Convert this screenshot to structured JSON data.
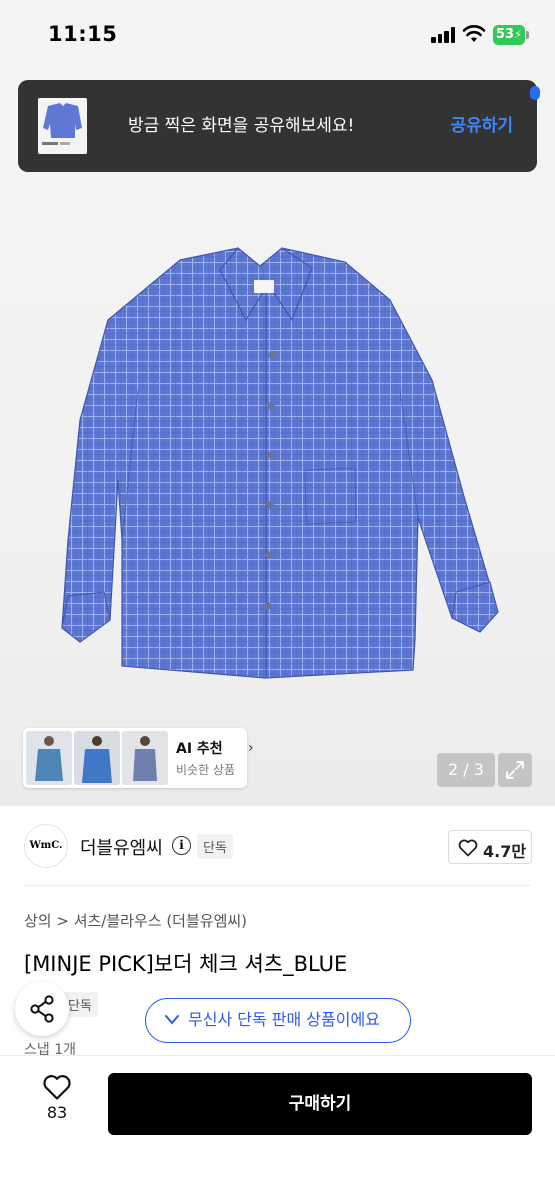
{
  "status_bar": {
    "time": "11:15",
    "battery": "53"
  },
  "toast": {
    "message": "방금 찍은 화면을 공유해보세요!",
    "action": "공유하기"
  },
  "gallery": {
    "pager": "2 / 3",
    "ai": {
      "title": "AI 추천",
      "subtitle": "비슷한 상품",
      "chevron": "›"
    }
  },
  "brand": {
    "logo_text": "WmC.",
    "name": "더블유엠씨",
    "info_glyph": "i",
    "badge": "단독",
    "likes": "4.7만"
  },
  "product": {
    "breadcrumb": "상의 > 셔츠/블라우스 (더블유엠씨)",
    "title": "[MINJE PICK]보더 체크 셔츠_BLUE",
    "badge": "단독",
    "exclusive_notice": "무신사 단독 판매 상품이에요",
    "snap": "스냅 1개"
  },
  "bottom": {
    "wish_count": "83",
    "buy_label": "구매하기"
  },
  "colors": {
    "accent": "#2d5ee5",
    "toast_action": "#3f86f8",
    "shirt": "#5f78d3",
    "toast_bg": "#333333"
  }
}
